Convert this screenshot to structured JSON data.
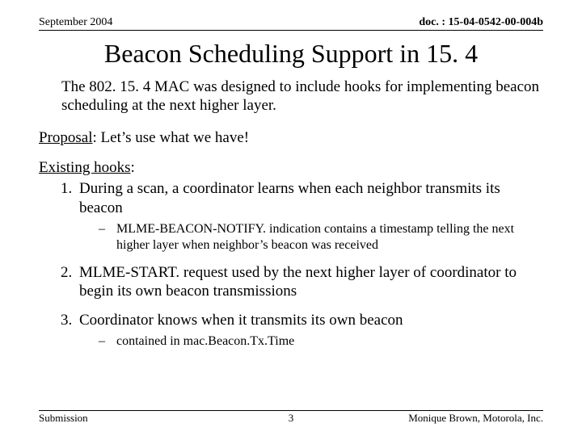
{
  "header": {
    "date": "September 2004",
    "doc_id": "doc. : 15-04-0542-00-004b"
  },
  "title": "Beacon Scheduling Support in 15. 4",
  "intro": "The 802. 15. 4 MAC was designed to include hooks for implementing beacon scheduling at the next higher layer.",
  "proposal": {
    "label": "Proposal",
    "text": ": Let’s use what we have!"
  },
  "hooks": {
    "label": "Existing hooks",
    "colon": ":",
    "items": [
      {
        "text": "During a scan, a coordinator learns when each neighbor transmits its beacon",
        "sub": "MLME-BEACON-NOTIFY. indication contains a timestamp telling the next higher layer when neighbor’s beacon was received"
      },
      {
        "text": "MLME-START. request used by the next higher layer of coordinator to begin its own beacon transmissions"
      },
      {
        "text": "Coordinator knows when it transmits its own beacon",
        "sub": "contained in mac.Beacon.Tx.Time"
      }
    ]
  },
  "footer": {
    "left": "Submission",
    "center": "3",
    "right": "Monique Brown, Motorola, Inc."
  }
}
